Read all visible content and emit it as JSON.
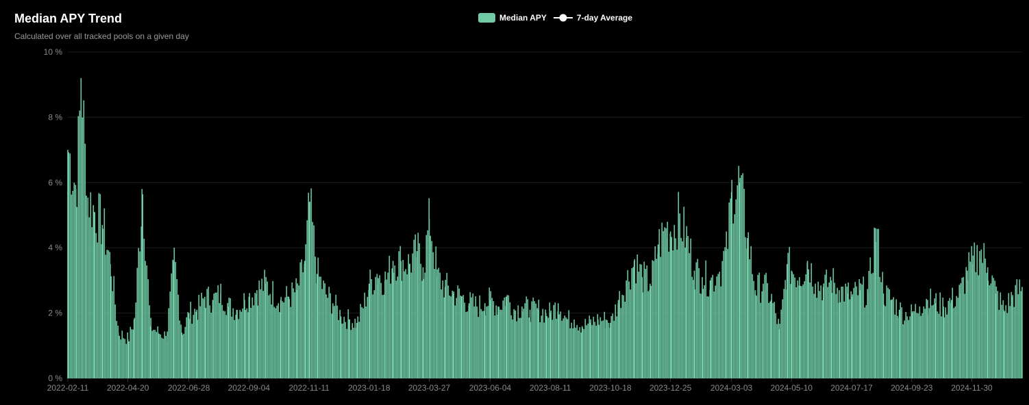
{
  "chart_data": {
    "type": "bar",
    "title": "Median APY Trend",
    "subtitle": "Calculated over all tracked pools on a given day",
    "legend": [
      {
        "name": "Median APY",
        "kind": "bar",
        "color": "#6fcaa5"
      },
      {
        "name": "7-day Average",
        "kind": "line-marker",
        "color": "#ffffff"
      }
    ],
    "legend_position": "top-center",
    "y_unit_suffix": " %",
    "ylim": [
      0,
      10
    ],
    "y_ticks": [
      "0 %",
      "2 %",
      "4 %",
      "6 %",
      "8 %",
      "10 %"
    ],
    "x_ticks": [
      "2022-02-11",
      "2022-04-20",
      "2022-06-28",
      "2022-09-04",
      "2022-11-11",
      "2023-01-18",
      "2023-03-27",
      "2023-06-04",
      "2023-08-11",
      "2023-10-18",
      "2023-12-25",
      "2024-03-03",
      "2024-05-10",
      "2024-07-17",
      "2024-09-23",
      "2024-11-30"
    ],
    "x_start": "2022-02-11",
    "x_end": "2025-01-26",
    "grid": "horizontal",
    "bar_color": "#6fcaa5",
    "series": [
      {
        "name": "Median APY",
        "x_dates": [
          "2022-02-11",
          "2022-02-20",
          "2022-02-26",
          "2022-03-04",
          "2022-03-13",
          "2022-03-22",
          "2022-03-31",
          "2022-04-09",
          "2022-04-20",
          "2022-04-27",
          "2022-05-06",
          "2022-05-15",
          "2022-05-24",
          "2022-06-02",
          "2022-06-11",
          "2022-06-20",
          "2022-06-28",
          "2022-07-07",
          "2022-07-16",
          "2022-07-25",
          "2022-08-03",
          "2022-08-12",
          "2022-08-21",
          "2022-08-30",
          "2022-09-04",
          "2022-09-13",
          "2022-09-22",
          "2022-10-01",
          "2022-10-10",
          "2022-10-19",
          "2022-10-28",
          "2022-11-06",
          "2022-11-11",
          "2022-11-20",
          "2022-11-29",
          "2022-12-08",
          "2022-12-17",
          "2022-12-26",
          "2023-01-04",
          "2023-01-13",
          "2023-01-18",
          "2023-01-27",
          "2023-02-05",
          "2023-02-14",
          "2023-02-23",
          "2023-03-04",
          "2023-03-13",
          "2023-03-20",
          "2023-03-27",
          "2023-04-05",
          "2023-04-14",
          "2023-04-23",
          "2023-05-02",
          "2023-05-11",
          "2023-05-20",
          "2023-05-29",
          "2023-06-04",
          "2023-06-13",
          "2023-06-22",
          "2023-07-01",
          "2023-07-10",
          "2023-07-19",
          "2023-07-28",
          "2023-08-06",
          "2023-08-11",
          "2023-08-20",
          "2023-08-29",
          "2023-09-07",
          "2023-09-16",
          "2023-09-25",
          "2023-10-04",
          "2023-10-13",
          "2023-10-18",
          "2023-10-27",
          "2023-11-05",
          "2023-11-14",
          "2023-11-23",
          "2023-12-02",
          "2023-12-11",
          "2023-12-20",
          "2023-12-25",
          "2024-01-03",
          "2024-01-12",
          "2024-01-21",
          "2024-01-30",
          "2024-02-08",
          "2024-02-17",
          "2024-02-26",
          "2024-03-03",
          "2024-03-12",
          "2024-03-21",
          "2024-03-30",
          "2024-04-08",
          "2024-04-17",
          "2024-04-26",
          "2024-05-05",
          "2024-05-10",
          "2024-05-19",
          "2024-05-28",
          "2024-06-06",
          "2024-06-15",
          "2024-06-24",
          "2024-07-03",
          "2024-07-12",
          "2024-07-17",
          "2024-07-26",
          "2024-08-04",
          "2024-08-13",
          "2024-08-22",
          "2024-08-31",
          "2024-09-09",
          "2024-09-18",
          "2024-09-23",
          "2024-10-02",
          "2024-10-11",
          "2024-10-20",
          "2024-10-29",
          "2024-11-07",
          "2024-11-16",
          "2024-11-25",
          "2024-11-30",
          "2024-12-09",
          "2024-12-18",
          "2024-12-27",
          "2025-01-05",
          "2025-01-14",
          "2025-01-26"
        ],
        "values": [
          7.0,
          5.8,
          9.2,
          5.6,
          5.1,
          4.7,
          3.5,
          1.4,
          1.2,
          1.8,
          5.8,
          1.6,
          1.4,
          1.3,
          3.6,
          1.4,
          2.0,
          2.1,
          2.5,
          2.4,
          2.6,
          2.2,
          2.1,
          2.4,
          2.5,
          2.7,
          2.9,
          2.6,
          2.4,
          2.5,
          2.7,
          3.6,
          5.4,
          3.2,
          2.6,
          2.3,
          1.9,
          1.8,
          1.7,
          2.4,
          2.9,
          3.2,
          3.0,
          3.6,
          3.6,
          3.5,
          3.9,
          3.4,
          4.9,
          3.1,
          2.8,
          2.6,
          2.5,
          2.3,
          2.2,
          2.3,
          2.4,
          2.2,
          2.5,
          2.1,
          2.2,
          2.1,
          2.1,
          2.0,
          2.0,
          2.3,
          1.8,
          1.8,
          1.6,
          1.7,
          1.8,
          1.8,
          1.7,
          2.4,
          3.0,
          3.6,
          3.1,
          2.9,
          4.1,
          4.6,
          4.5,
          4.9,
          4.3,
          3.3,
          3.1,
          3.0,
          3.2,
          3.9,
          5.7,
          6.0,
          4.3,
          2.7,
          2.9,
          2.4,
          1.5,
          3.5,
          3.3,
          3.1,
          3.6,
          2.9,
          2.8,
          3.0,
          2.7,
          2.6,
          2.5,
          2.7,
          2.6,
          4.6,
          2.6,
          2.4,
          2.1,
          1.9,
          2.0,
          2.2,
          2.4,
          2.3,
          2.2,
          2.4,
          2.6,
          3.3,
          3.5,
          3.9,
          3.4,
          2.6,
          2.1,
          2.5,
          2.8
        ]
      }
    ]
  }
}
